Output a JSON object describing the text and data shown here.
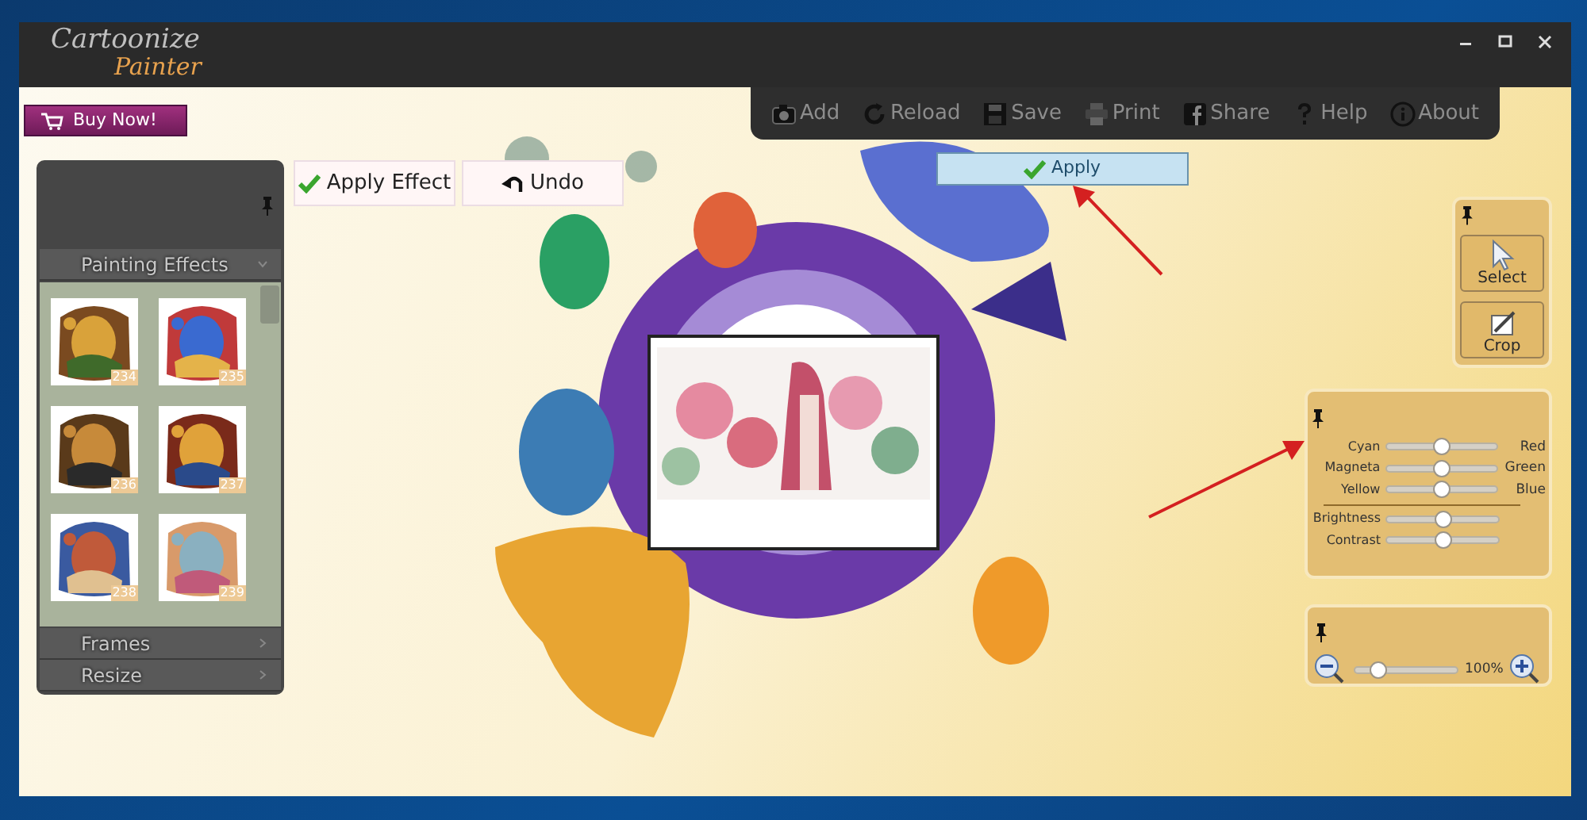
{
  "window": {
    "logo_line_1": "Cartoonize",
    "logo_line_2": "Painter",
    "controls": [
      {
        "kind": "minimize"
      },
      {
        "kind": "maximize"
      },
      {
        "kind": "close"
      }
    ]
  },
  "buy_button": {
    "label": "Buy Now!"
  },
  "toolbar": [
    {
      "label": "Add",
      "kind": "camera"
    },
    {
      "label": "Reload",
      "kind": "reload"
    },
    {
      "label": "Save",
      "kind": "save"
    },
    {
      "label": "Print",
      "kind": "print"
    },
    {
      "label": "Share",
      "kind": "share"
    },
    {
      "label": "Help",
      "kind": "help"
    },
    {
      "label": "About",
      "kind": "about"
    }
  ],
  "apply_button": {
    "label": "Apply"
  },
  "effect_buttons": [
    {
      "label": "Apply Effect",
      "kind": "check"
    },
    {
      "label": "Undo",
      "kind": "undo"
    }
  ],
  "left_panel": {
    "sections": [
      {
        "label": "Painting Effects",
        "expanded": true
      },
      {
        "label": "Frames",
        "expanded": false
      },
      {
        "label": "Resize",
        "expanded": false
      }
    ],
    "thumbnails": [
      "234",
      "235",
      "236",
      "237",
      "238",
      "239"
    ]
  },
  "tools": [
    {
      "label": "Select",
      "kind": "select"
    },
    {
      "label": "Crop",
      "kind": "crop"
    }
  ],
  "color_sliders": [
    {
      "left": "Cyan",
      "right": "Red",
      "level": 0.5
    },
    {
      "left": "Magneta",
      "right": "Green",
      "level": 0.5
    },
    {
      "left": "Yellow",
      "right": "Blue",
      "level": 0.5
    }
  ],
  "tone_sliders": [
    {
      "label": "Brightness",
      "level": 0.5
    },
    {
      "label": "Contrast",
      "level": 0.5
    }
  ],
  "zoom": {
    "level": 0.22,
    "reading": "100%"
  }
}
